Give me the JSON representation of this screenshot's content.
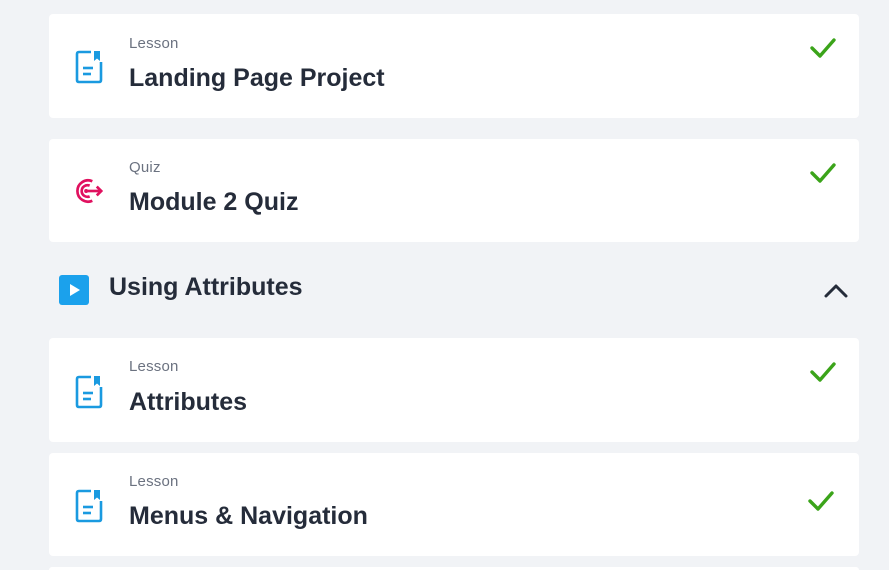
{
  "items_top": [
    {
      "type": "Lesson",
      "title": "Landing Page Project",
      "icon": "lesson-document-icon",
      "completed": true
    },
    {
      "type": "Quiz",
      "title": "Module 2 Quiz",
      "icon": "quiz-target-icon",
      "completed": true
    }
  ],
  "section": {
    "title": "Using Attributes",
    "icon": "play-icon",
    "toggle_icon": "chevron-up-icon",
    "expanded": true
  },
  "items_section": [
    {
      "type": "Lesson",
      "title": "Attributes",
      "icon": "lesson-document-icon",
      "completed": true
    },
    {
      "type": "Lesson",
      "title": "Menus & Navigation",
      "icon": "lesson-document-icon",
      "completed": true
    }
  ],
  "colors": {
    "background": "#f1f3f6",
    "card": "#ffffff",
    "lesson_icon": "#1a9ae0",
    "quiz_icon": "#e0115f",
    "play_icon_bg": "#1ba1ec",
    "check": "#3ba41a",
    "title_text": "#252c3a",
    "type_text": "#6b7280"
  }
}
